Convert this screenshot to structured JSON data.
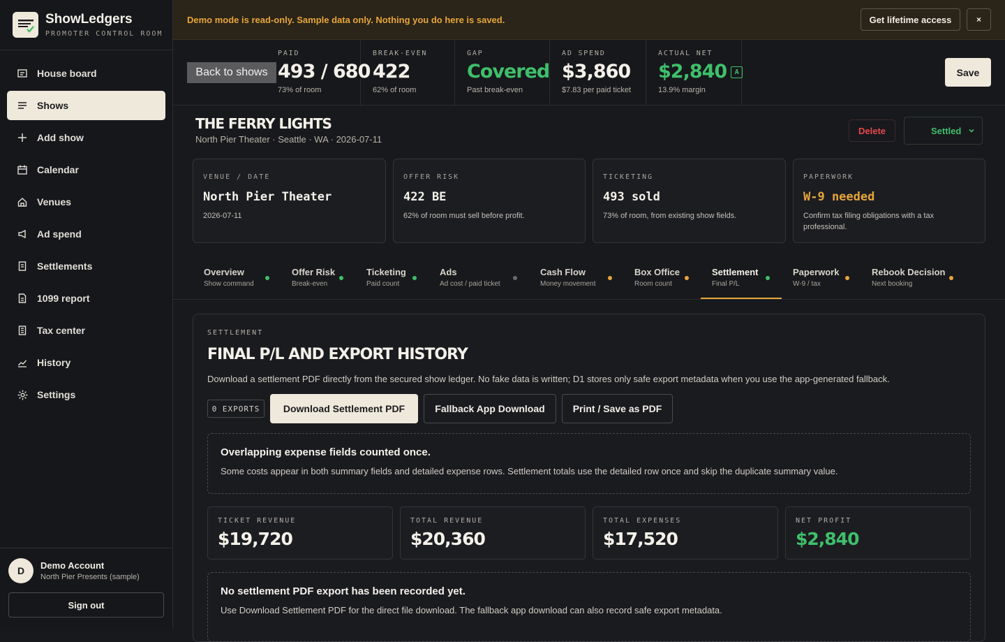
{
  "brand": {
    "name": "ShowLedgers",
    "subtitle": "PROMOTER CONTROL ROOM"
  },
  "nav": [
    {
      "label": "House board",
      "icon": "board-icon"
    },
    {
      "label": "Shows",
      "icon": "list-icon",
      "active": true
    },
    {
      "label": "Add show",
      "icon": "plus-icon"
    },
    {
      "label": "Calendar",
      "icon": "calendar-icon"
    },
    {
      "label": "Venues",
      "icon": "home-icon"
    },
    {
      "label": "Ad spend",
      "icon": "megaphone-icon"
    },
    {
      "label": "Settlements",
      "icon": "receipt-icon"
    },
    {
      "label": "1099 report",
      "icon": "document-icon"
    },
    {
      "label": "Tax center",
      "icon": "ledger-icon"
    },
    {
      "label": "History",
      "icon": "trend-icon"
    },
    {
      "label": "Settings",
      "icon": "gear-icon"
    }
  ],
  "account": {
    "initial": "D",
    "name": "Demo Account",
    "org": "North Pier Presents (sample)",
    "signout": "Sign out"
  },
  "banner": {
    "text": "Demo mode is read-only. Sample data only. Nothing you do here is saved.",
    "cta": "Get lifetime access",
    "close": "×"
  },
  "stats": {
    "back": "Back to shows",
    "items": [
      {
        "label": "PAID",
        "value": "493 / 680",
        "sub": "73% of room"
      },
      {
        "label": "BREAK-EVEN",
        "value": "422",
        "sub": "62% of room"
      },
      {
        "label": "GAP",
        "value": "Covered",
        "sub": "Past break-even"
      },
      {
        "label": "AD SPEND",
        "value": "$3,860",
        "sub": "$7.83 per paid ticket"
      },
      {
        "label": "ACTUAL NET",
        "value": "$2,840",
        "sub": "13.9% margin",
        "badge": "A"
      }
    ],
    "save": "Save"
  },
  "show": {
    "title": "THE FERRY LIGHTS",
    "subtitle": "North Pier Theater · Seattle · WA · 2026-07-11",
    "delete": "Delete",
    "status": "Settled"
  },
  "cards": [
    {
      "label": "VENUE / DATE",
      "value": "North Pier Theater",
      "sub": "2026-07-11"
    },
    {
      "label": "OFFER RISK",
      "value": "422 BE",
      "sub": "62% of room must sell before profit."
    },
    {
      "label": "TICKETING",
      "value": "493 sold",
      "sub": "73% of room, from existing show fields."
    },
    {
      "label": "PAPERWORK",
      "value": "W-9 needed",
      "sub": "Confirm tax filing obligations with a tax professional."
    }
  ],
  "tabs": [
    {
      "label": "Overview",
      "sub": "Show command",
      "dot": "#3fbf6b"
    },
    {
      "label": "Offer Risk",
      "sub": "Break-even",
      "dot": "#3fbf6b"
    },
    {
      "label": "Ticketing",
      "sub": "Paid count",
      "dot": "#3fbf6b"
    },
    {
      "label": "Ads",
      "sub": "Ad cost / paid ticket",
      "dot": "#6b6b6e"
    },
    {
      "label": "Cash Flow",
      "sub": "Money movement",
      "dot": "#e7a63b"
    },
    {
      "label": "Box Office",
      "sub": "Room count",
      "dot": "#e7a63b"
    },
    {
      "label": "Settlement",
      "sub": "Final P/L",
      "dot": "#3fbf6b",
      "active": true
    },
    {
      "label": "Paperwork",
      "sub": "W-9 / tax",
      "dot": "#e7a63b"
    },
    {
      "label": "Rebook Decision",
      "sub": "Next booking",
      "dot": "#e7a63b"
    }
  ],
  "settlement": {
    "eyebrow": "SETTLEMENT",
    "title": "FINAL P/L AND EXPORT HISTORY",
    "description": "Download a settlement PDF directly from the secured show ledger. No fake data is written; D1 stores only safe export metadata when you use the app-generated fallback.",
    "exports": "0 EXPORTS",
    "buttons": {
      "download": "Download Settlement PDF",
      "fallback": "Fallback App Download",
      "print": "Print / Save as PDF"
    },
    "notice1": {
      "title": "Overlapping expense fields counted once.",
      "body": "Some costs appear in both summary fields and detailed expense rows. Settlement totals use the detailed row once and skip the duplicate summary value."
    },
    "metrics": [
      {
        "label": "TICKET REVENUE",
        "value": "$19,720"
      },
      {
        "label": "TOTAL REVENUE",
        "value": "$20,360"
      },
      {
        "label": "TOTAL EXPENSES",
        "value": "$17,520"
      },
      {
        "label": "NET PROFIT",
        "value": "$2,840"
      }
    ],
    "notice2": {
      "title": "No settlement PDF export has been recorded yet.",
      "body": "Use Download Settlement PDF for the direct file download. The fallback app download can also record safe export metadata."
    }
  },
  "colors": {
    "accent": "#e7a63b",
    "positive": "#3fbf6b",
    "danger": "#e5484d",
    "cream": "#efe9dc"
  }
}
